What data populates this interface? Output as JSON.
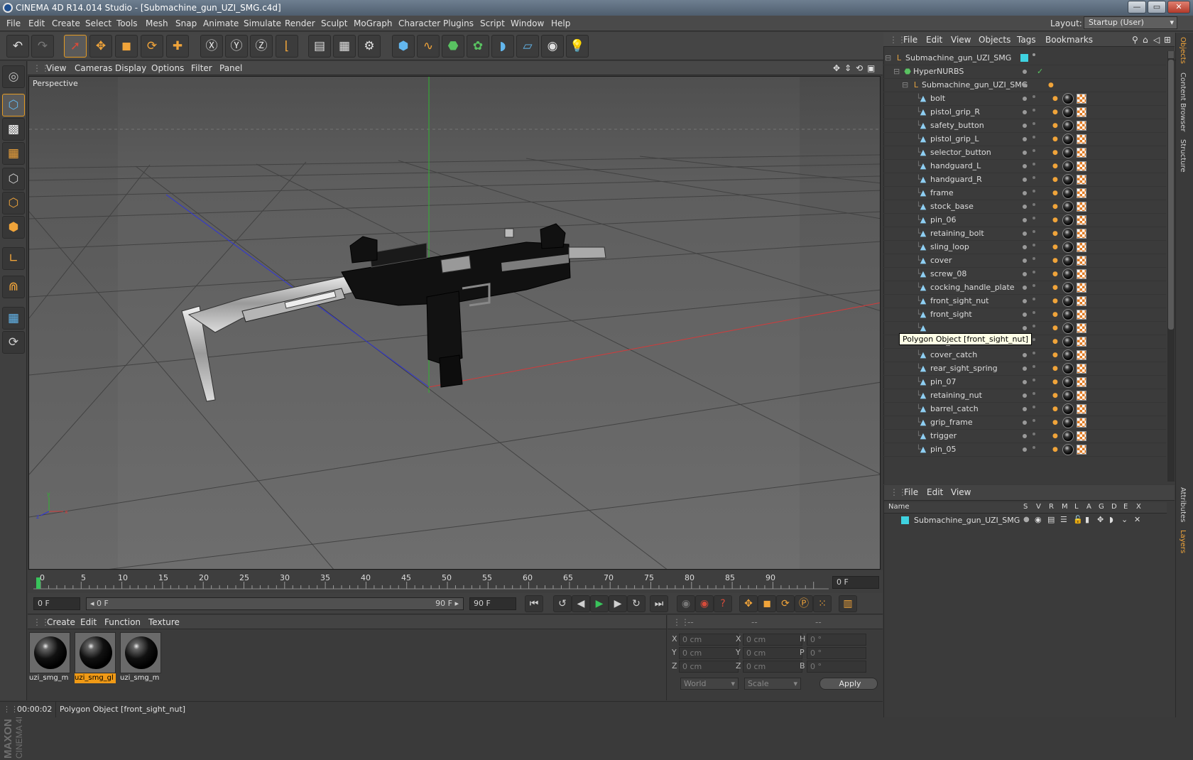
{
  "window": {
    "title": "CINEMA 4D R14.014 Studio - [Submachine_gun_UZI_SMG.c4d]",
    "btn_min": "—",
    "btn_max": "▭",
    "btn_close": "✕"
  },
  "menubar": {
    "items": [
      "File",
      "Edit",
      "Create",
      "Select",
      "Tools",
      "Mesh",
      "Snap",
      "Animate",
      "Simulate",
      "Render",
      "Sculpt",
      "MoGraph",
      "Character",
      "Plugins",
      "Script",
      "Window",
      "Help"
    ],
    "layout_label": "Layout:",
    "layout_value": "Startup (User)"
  },
  "viewport": {
    "menu": [
      "View",
      "Cameras",
      "Display",
      "Options",
      "Filter",
      "Panel"
    ],
    "label": "Perspective",
    "tooltip": "Polygon Object [front_sight_nut]",
    "axis_x": "x",
    "axis_y": "y",
    "axis_z": "z"
  },
  "timeline": {
    "ticks": [
      "0",
      "5",
      "10",
      "15",
      "20",
      "25",
      "30",
      "35",
      "40",
      "45",
      "50",
      "55",
      "60",
      "65",
      "70",
      "75",
      "80",
      "85",
      "90"
    ],
    "current_frame": "0 F",
    "start_field": "0 F",
    "range_start": "◂ 0 F",
    "range_end": "90 F ▸",
    "end_field": "90 F"
  },
  "materials": {
    "menu": [
      "Create",
      "Edit",
      "Function",
      "Texture"
    ],
    "items": [
      {
        "name": "uzi_smg_m",
        "selected": false
      },
      {
        "name": "uzi_smg_gl",
        "selected": true
      },
      {
        "name": "uzi_smg_m",
        "selected": false
      }
    ]
  },
  "coords": {
    "header": [
      "--",
      "--",
      "--"
    ],
    "rows": [
      {
        "a": "X",
        "av": "0 cm",
        "b": "X",
        "bv": "0 cm",
        "c": "H",
        "cv": "0 °"
      },
      {
        "a": "Y",
        "av": "0 cm",
        "b": "Y",
        "bv": "0 cm",
        "c": "P",
        "cv": "0 °"
      },
      {
        "a": "Z",
        "av": "0 cm",
        "b": "Z",
        "bv": "0 cm",
        "c": "B",
        "cv": "0 °"
      }
    ],
    "mode1": "World",
    "mode2": "Scale",
    "apply": "Apply"
  },
  "status": {
    "time": "00:00:02",
    "message": "Polygon Object [front_sight_nut]"
  },
  "objects": {
    "menu": [
      "File",
      "Edit",
      "View",
      "Objects",
      "Tags",
      "Bookmarks"
    ],
    "root": "Submachine_gun_UZI_SMG",
    "hypernurbs": "HyperNURBS",
    "group": "Submachine_gun_UZI_SMG",
    "children": [
      "bolt",
      "pistol_grip_R",
      "safety_button",
      "pistol_grip_L",
      "selector_button",
      "handguard_L",
      "handguard_R",
      "frame",
      "stock_base",
      "pin_06",
      "retaining_bolt",
      "sling_loop",
      "cover",
      "screw_08",
      "cocking_handle_plate",
      "front_sight_nut",
      "front_sight",
      "",
      "rear_sight",
      "cover_catch",
      "rear_sight_spring",
      "pin_07",
      "retaining_nut",
      "barrel_catch",
      "grip_frame",
      "trigger",
      "pin_05"
    ]
  },
  "layers": {
    "menu": [
      "File",
      "Edit",
      "View"
    ],
    "columns": [
      "Name",
      "S",
      "V",
      "R",
      "M",
      "L",
      "A",
      "G",
      "D",
      "E",
      "X"
    ],
    "rows": [
      {
        "name": "Submachine_gun_UZI_SMG",
        "color": "#3fd2e0"
      }
    ]
  },
  "sidetabs": [
    "Objects",
    "Content Browser",
    "Structure",
    "Attributes",
    "Layers"
  ],
  "colors": {
    "accent": "#f09a16",
    "layer_color": "#3fd2e0"
  }
}
